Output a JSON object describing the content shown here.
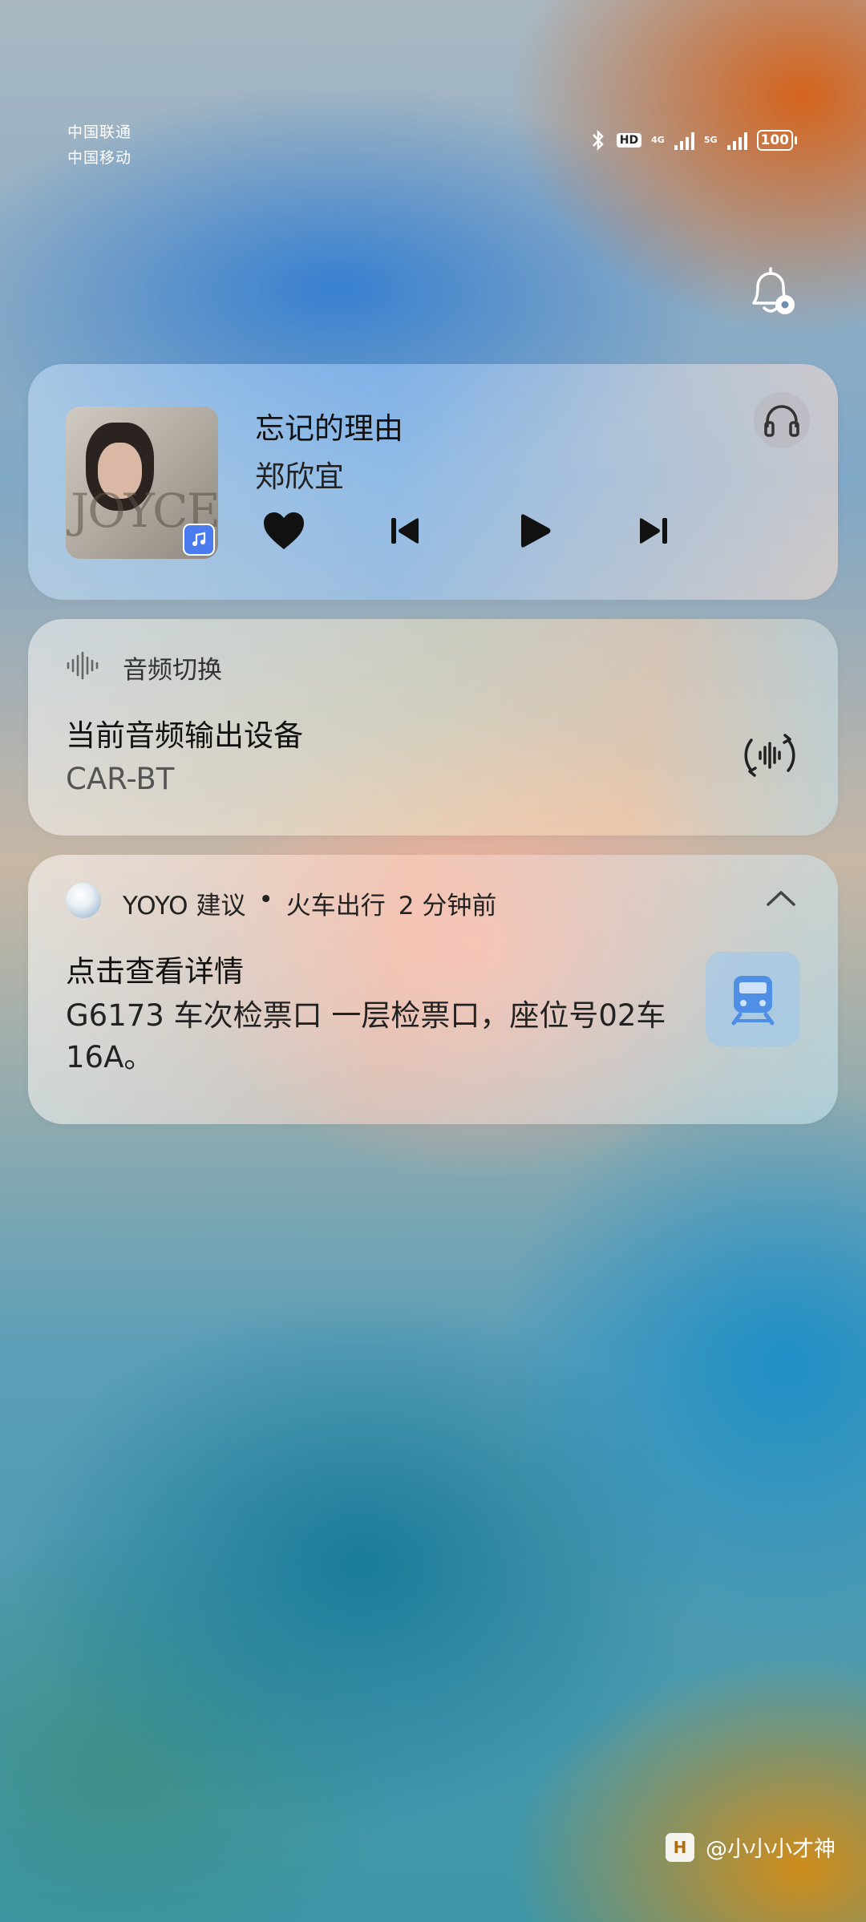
{
  "status_bar": {
    "carrier_1": "中国联通",
    "carrier_2": "中国移动",
    "hd": "HD",
    "net_1": "4G",
    "net_2": "5G",
    "battery": "100"
  },
  "notification_settings_icon": "bell-gear-icon",
  "music": {
    "title": "忘记的理由",
    "artist": "郑欣宜",
    "album_art_text": "JOYCE",
    "app_badge_icon": "music-note-icon",
    "controls": [
      "heart-icon",
      "previous-icon",
      "play-icon",
      "next-icon"
    ],
    "output_icon": "headphones-icon"
  },
  "audio_switch": {
    "header": "音频切换",
    "title": "当前音频输出设备",
    "device": "CAR-BT",
    "icon": "audio-wave-icon"
  },
  "yoyo": {
    "app": "YOYO 建议",
    "dot": "•",
    "category": "火车出行",
    "time": "2 分钟前",
    "title": "点击查看详情",
    "body": "G6173 车次检票口 一层检票口，座位号02车16A。",
    "tile_icon": "train-icon",
    "collapse_icon": "chevron-up-icon"
  },
  "watermark": {
    "logo_text": "H",
    "text": "@小小小才神"
  }
}
